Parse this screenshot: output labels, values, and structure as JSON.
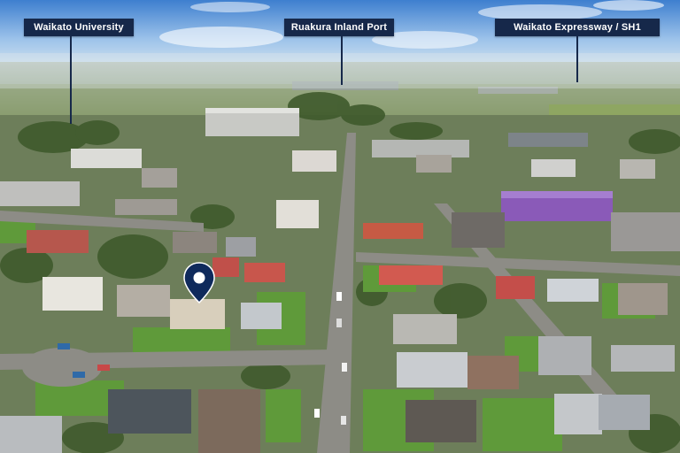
{
  "labels": {
    "university": "Waikato University",
    "inland_port": "Ruakura Inland Port",
    "expressway": "Waikato Expressway / SH1"
  },
  "colors": {
    "label_bg": "#16284a",
    "label_text": "#ffffff",
    "pin": "#0f2a5c"
  },
  "icons": {
    "property_marker": "map-pin-icon"
  }
}
